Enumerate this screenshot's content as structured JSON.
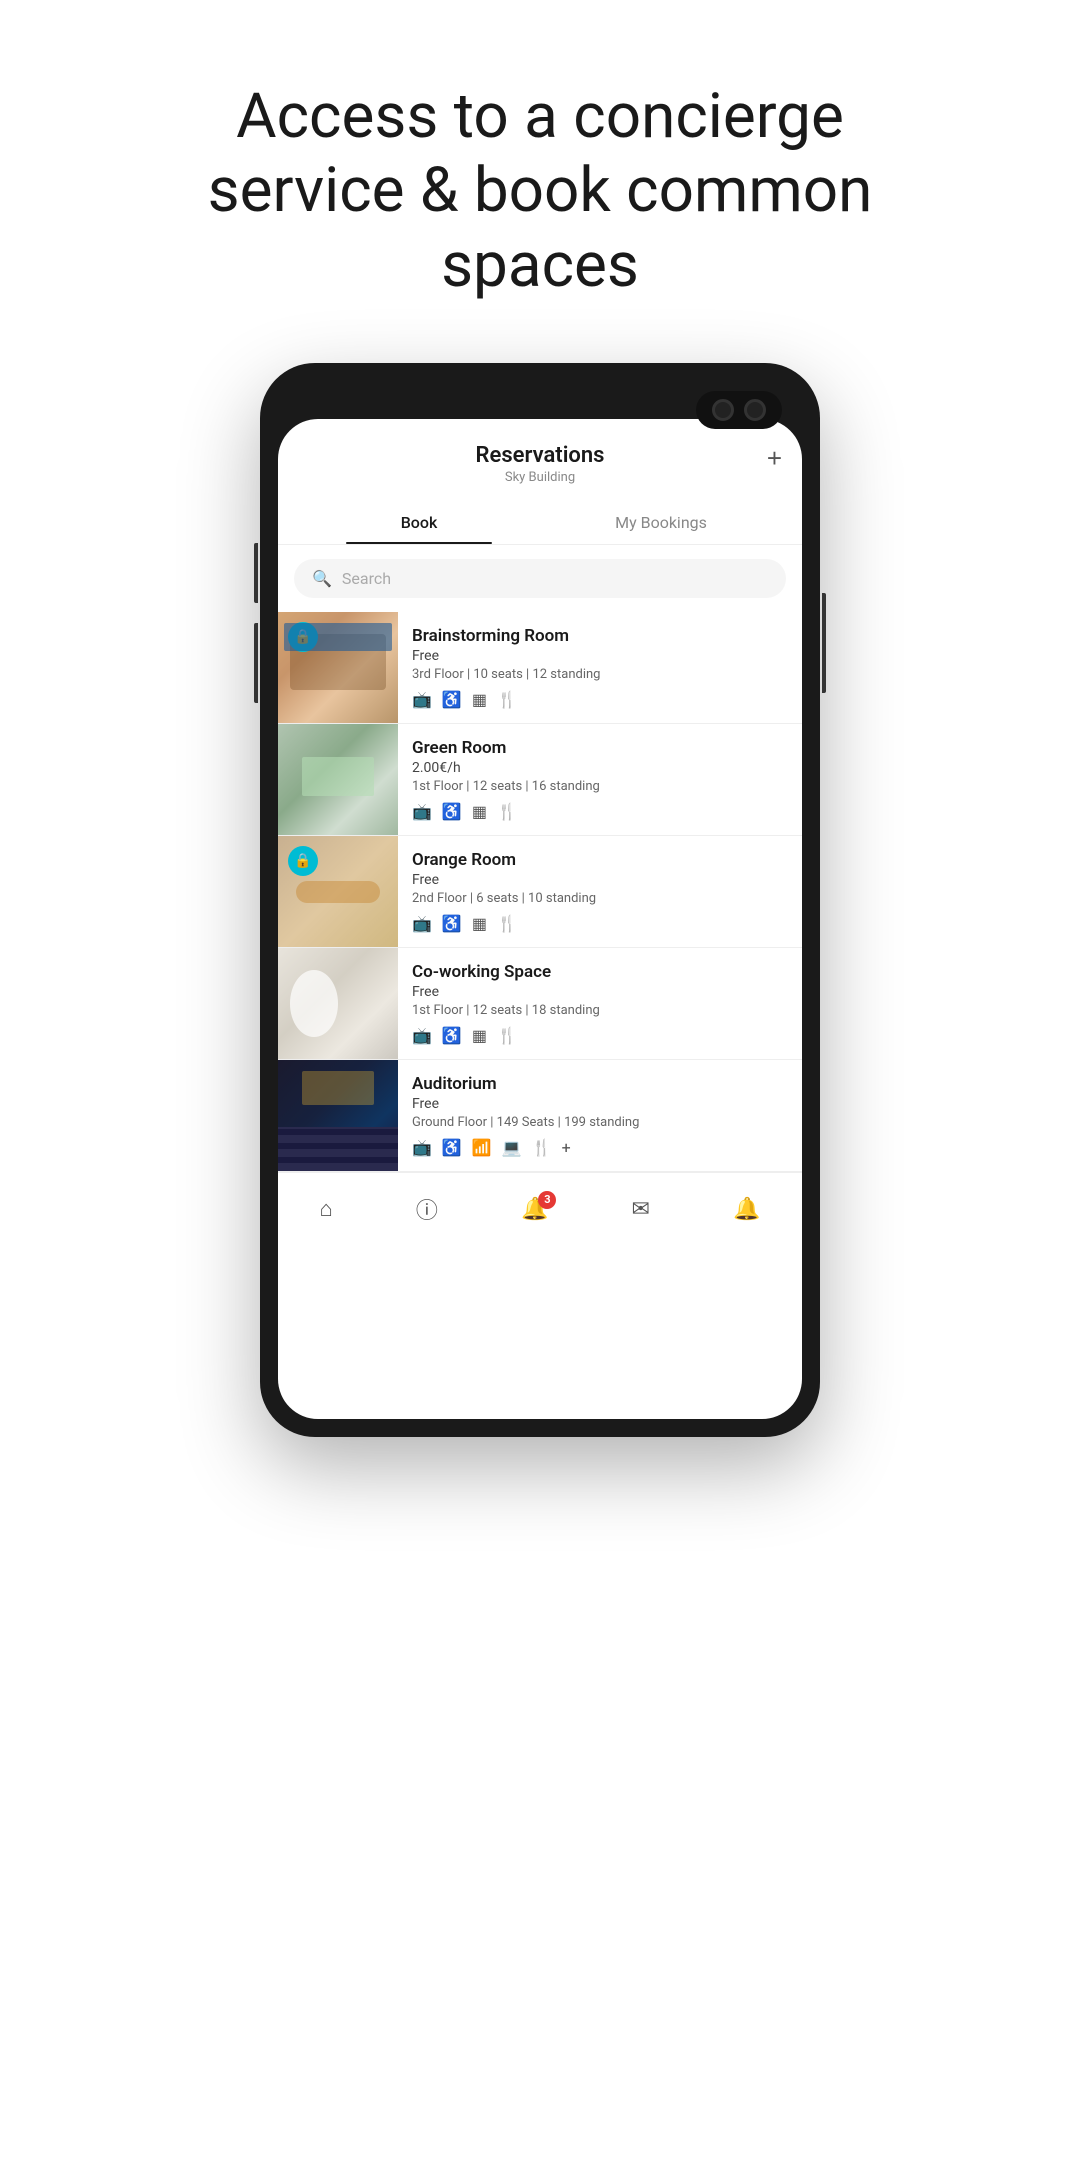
{
  "hero": {
    "title": "Access to a concierge service & book common spaces"
  },
  "app": {
    "title": "Reservations",
    "subtitle": "Sky Building",
    "add_button": "+",
    "tabs": [
      {
        "label": "Book",
        "active": true
      },
      {
        "label": "My Bookings",
        "active": false
      }
    ]
  },
  "search": {
    "placeholder": "Search"
  },
  "rooms": [
    {
      "name": "Brainstorming Room",
      "price": "Free",
      "details": "3rd Floor | 10 seats | 12 standing",
      "thumb_class": "thumb-brainstorm",
      "has_lock": true
    },
    {
      "name": "Green Room",
      "price": "2.00€/h",
      "details": "1st Floor | 12 seats | 16 standing",
      "thumb_class": "thumb-green",
      "has_lock": false
    },
    {
      "name": "Orange Room",
      "price": "Free",
      "details": "2nd Floor | 6 seats | 10 standing",
      "thumb_class": "thumb-orange",
      "has_lock": true
    },
    {
      "name": "Co-working Space",
      "price": "Free",
      "details": "1st Floor | 12 seats | 18 standing",
      "thumb_class": "thumb-coworking",
      "has_lock": false
    },
    {
      "name": "Auditorium",
      "price": "Free",
      "details": "Ground Floor | 149 Seats | 199 standing",
      "thumb_class": "thumb-auditorium",
      "has_lock": false
    }
  ],
  "nav": {
    "items": [
      {
        "icon": "⌂",
        "label": "home",
        "badge": null
      },
      {
        "icon": "ℹ",
        "label": "info",
        "badge": null
      },
      {
        "icon": "🔔",
        "label": "notifications",
        "badge": "3"
      },
      {
        "icon": "✉",
        "label": "messages",
        "badge": null
      },
      {
        "icon": "🔔",
        "label": "alerts",
        "badge": null
      }
    ]
  },
  "colors": {
    "accent": "#00bcd4",
    "tab_active": "#1a1a1a",
    "badge_red": "#e53935"
  }
}
